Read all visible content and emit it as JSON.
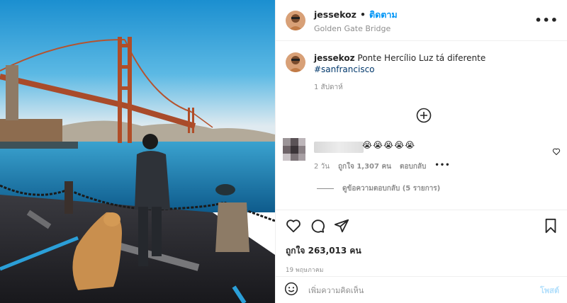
{
  "post": {
    "username": "jessekoz",
    "follow_label": "ติดตาม",
    "location": "Golden Gate Bridge",
    "more_label": "•••"
  },
  "caption": {
    "username": "jessekoz",
    "text": "Ponte Hercílio Luz tá diferente",
    "hashtag": "#sanfrancisco",
    "time": "1 สัปดาห์"
  },
  "comment": {
    "emoji": "😭😭😭😭😭",
    "age": "2 วัน",
    "likes": "ถูกใจ 1,307 คน",
    "reply_label": "ตอบกลับ",
    "more": "•••",
    "view_replies": "ดูข้อความตอบกลับ (5 รายการ)"
  },
  "actions": {
    "likes": "ถูกใจ 263,013 คน",
    "date": "19 พฤษภาคม"
  },
  "comment_box": {
    "placeholder": "เพิ่มความคิดเห็น",
    "post_label": "โพสต์"
  },
  "colors": {
    "accent": "#0095f6",
    "sky": "#2aa3d9",
    "bridge": "#b5532e",
    "water": "#1f7fb0"
  }
}
